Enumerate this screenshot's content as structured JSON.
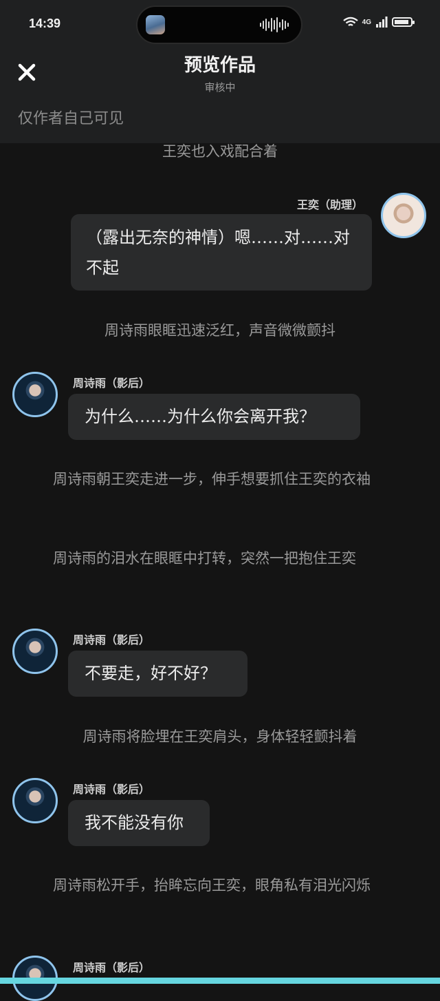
{
  "status_bar": {
    "time": "14:39",
    "network": "4G"
  },
  "header": {
    "title": "预览作品",
    "subtitle": "审核中",
    "visibility_note": "仅作者自己可见"
  },
  "feed": [
    {
      "type": "narration",
      "text": "王奕也入戏配合着"
    },
    {
      "type": "message",
      "speaker": "王奕（助理）",
      "text": "（露出无奈的神情）嗯……对……对不起"
    },
    {
      "type": "narration",
      "text": "周诗雨眼眶迅速泛红，声音微微颤抖"
    },
    {
      "type": "message",
      "speaker": "周诗雨（影后）",
      "text": "为什么……为什么你会离开我？"
    },
    {
      "type": "narration",
      "text": "周诗雨朝王奕走进一步，伸手想要抓住王奕的衣袖"
    },
    {
      "type": "narration",
      "text": "周诗雨的泪水在眼眶中打转，突然一把抱住王奕"
    },
    {
      "type": "message",
      "speaker": "周诗雨（影后）",
      "text": "不要走，好不好？"
    },
    {
      "type": "narration",
      "text": "周诗雨将脸埋在王奕肩头，身体轻轻颤抖着"
    },
    {
      "type": "message",
      "speaker": "周诗雨（影后）",
      "text": "我不能没有你"
    },
    {
      "type": "narration",
      "text": "周诗雨松开手，抬眸忘向王奕，眼角私有泪光闪烁"
    },
    {
      "type": "message",
      "speaker": "周诗雨（影后）",
      "text": ""
    }
  ],
  "colors": {
    "background": "#141414",
    "header_bg": "#1f2021",
    "bubble_bg": "#2a2b2c",
    "avatar_ring": "#8fc4ec",
    "bottom_accent": "#66d6e0"
  },
  "icons": {
    "close": "close-icon",
    "wifi": "wifi-icon",
    "signal": "signal-icon",
    "battery": "battery-icon"
  }
}
